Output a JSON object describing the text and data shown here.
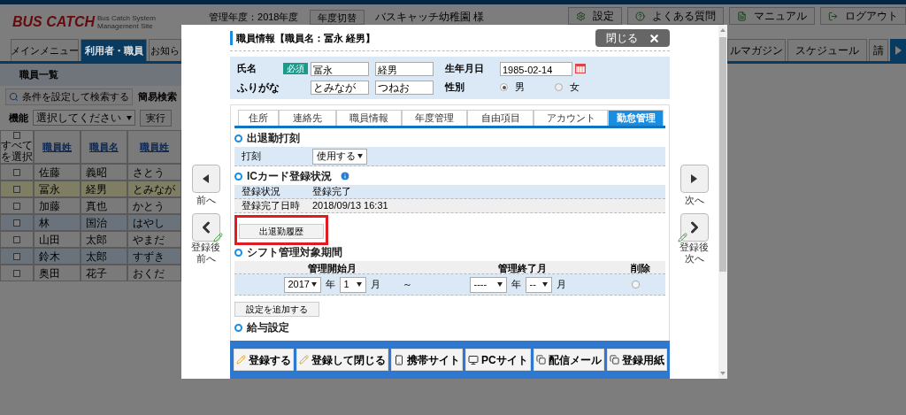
{
  "header": {
    "logo": "BUS CATCH",
    "subtitle": [
      "Bus Catch System",
      "Management Site"
    ],
    "fiscal_year": "管理年度：2018年度",
    "switch_button": "年度切替",
    "org": "バスキャッチ幼稚園 様",
    "buttons": [
      {
        "label": "設定",
        "kind": "settings"
      },
      {
        "label": "よくある質問",
        "kind": "help"
      },
      {
        "label": "マニュアル",
        "kind": "manual"
      },
      {
        "label": "ログアウト",
        "kind": "logout"
      }
    ]
  },
  "nav_tabs": [
    {
      "label": "メインメニュー",
      "selected": false
    },
    {
      "label": "利用者・職員",
      "selected": true
    },
    {
      "label": "お知ら",
      "selected": false
    }
  ],
  "nav_tabs_right": [
    {
      "label": "ルマガジン",
      "selected": false
    },
    {
      "label": "スケジュール",
      "selected": false
    },
    {
      "label": "請",
      "selected": false
    }
  ],
  "page_title": "職員一覧",
  "search": {
    "button": "条件を設定して検索する",
    "quick_label": "簡易検索"
  },
  "actions": {
    "label": "機能",
    "select": "選択してください",
    "run_button": "実行"
  },
  "staff_table": {
    "select_all": "すべてを選択",
    "select_all_checked": false,
    "columns": [
      "職員姓",
      "職員名",
      "職員姓"
    ],
    "rows": [
      {
        "cells": [
          "佐藤",
          "義昭",
          "さとう"
        ],
        "color": "#7a7a7a",
        "checked": false
      },
      {
        "cells": [
          "冨永",
          "経男",
          "とみなが"
        ],
        "color": "#7f7d62",
        "checked": false
      },
      {
        "cells": [
          "加藤",
          "真也",
          "かとう"
        ],
        "color": "#7a7a7a",
        "checked": false
      },
      {
        "cells": [
          "林",
          "国治",
          "はやし"
        ],
        "color": "#6a737b",
        "checked": false
      },
      {
        "cells": [
          "山田",
          "太郎",
          "やまだ"
        ],
        "color": "#7a7a7a",
        "checked": false
      },
      {
        "cells": [
          "鈴木",
          "太郎",
          "すずき"
        ],
        "color": "#6a737b",
        "checked": false
      },
      {
        "cells": [
          "奥田",
          "花子",
          "おくだ"
        ],
        "color": "#7a7a7a",
        "checked": false
      }
    ]
  },
  "modal": {
    "title": "職員情報【職員名：冨永 経男】",
    "close_button": "閉じる",
    "prev_button": "前へ",
    "prev_after_save": "登録後前へ",
    "next_button": "次へ",
    "next_after_save": "登録後次へ",
    "name_panel": {
      "name_label": "氏名",
      "required_badge": "必須",
      "family_name": "冨永",
      "given_name": "経男",
      "birth_label": "生年月日",
      "birth_date": "1985-02-14",
      "kana_label": "ふりがな",
      "family_kana": "とみなが",
      "given_kana": "つねお",
      "gender_label": "性別",
      "genders": [
        {
          "label": "男",
          "selected": true
        },
        {
          "label": "女",
          "selected": false
        }
      ]
    },
    "tabs": [
      {
        "label": "住所",
        "selected": false
      },
      {
        "label": "連絡先",
        "selected": false
      },
      {
        "label": "職員情報",
        "selected": false
      },
      {
        "label": "年度管理",
        "selected": false
      },
      {
        "label": "自由項目",
        "selected": false
      },
      {
        "label": "アカウント",
        "selected": false
      },
      {
        "label": "勤怠管理",
        "selected": true
      }
    ],
    "stamp_section": {
      "title": "出退勤打刻",
      "label": "打刻",
      "value": "使用する"
    },
    "ic_section": {
      "title": "ICカード登録状況",
      "rows": [
        {
          "label": "登録状況",
          "value": "登録完了"
        },
        {
          "label": "登録完了日時",
          "value": "2018/09/13 16:31"
        }
      ]
    },
    "history_button": {
      "label": "出退勤履歴",
      "highlighted": true
    },
    "shift_section": {
      "title": "シフト管理対象期間",
      "columns": [
        "管理開始月",
        "管理終了月",
        "削除"
      ],
      "row": {
        "start_year": "2017",
        "start_year_unit": "年",
        "start_month": "1",
        "start_month_unit": "月",
        "tilde": "～",
        "end_year": "----",
        "end_year_unit": "年",
        "end_month": "--",
        "end_month_unit": "月",
        "delete": false
      },
      "add_button": "設定を追加する"
    },
    "salary_section": {
      "title": "給与設定"
    },
    "footer_buttons": [
      {
        "label": "登録する",
        "kind": "pencil"
      },
      {
        "label": "登録して閉じる",
        "kind": "pencil"
      },
      {
        "label": "携帯サイト",
        "kind": "phone"
      },
      {
        "label": "PCサイト",
        "kind": "monitor"
      },
      {
        "label": "配信メール",
        "kind": "copy"
      },
      {
        "label": "登録用紙",
        "kind": "copy"
      }
    ]
  }
}
